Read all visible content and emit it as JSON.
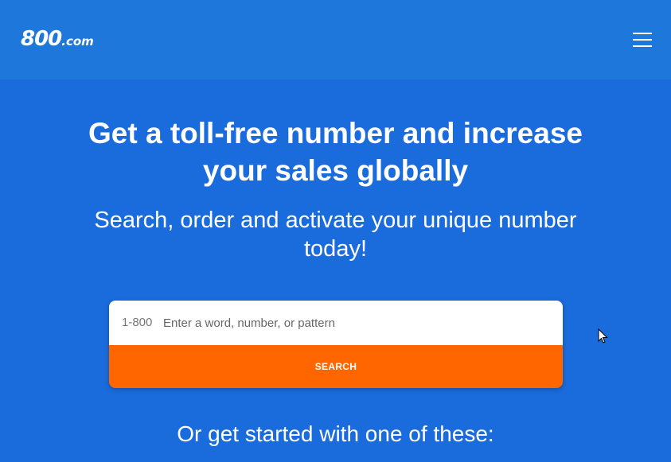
{
  "header": {
    "logo_main": "800",
    "logo_suffix": ".com",
    "menu_icon": "hamburger-menu-icon"
  },
  "hero": {
    "headline": "Get a toll-free number and increase your sales globally",
    "subheadline": "Search, order and activate your unique number today!"
  },
  "search": {
    "prefix": "1-800",
    "placeholder": "Enter a word, number, or pattern",
    "value": "",
    "button_label": "SEARCH"
  },
  "footer_prompt": "Or get started with one of these:",
  "colors": {
    "background": "#1a6bdb",
    "header": "#1e78dc",
    "accent": "#ff6600"
  }
}
